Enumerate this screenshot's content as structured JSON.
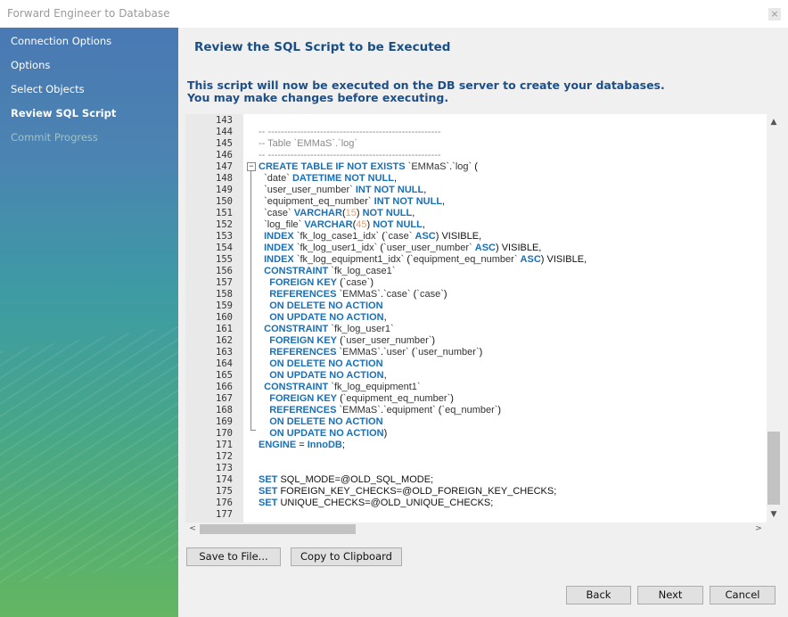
{
  "window": {
    "title": "Forward Engineer to Database",
    "close_glyph": "×"
  },
  "sidebar": {
    "steps": [
      {
        "label": "Connection Options",
        "state": "normal"
      },
      {
        "label": "Options",
        "state": "normal"
      },
      {
        "label": "Select Objects",
        "state": "normal"
      },
      {
        "label": "Review SQL Script",
        "state": "active"
      },
      {
        "label": "Commit Progress",
        "state": "disabled"
      }
    ]
  },
  "page": {
    "title": "Review the SQL Script to be Executed",
    "desc_line1": "This script will now be executed on the DB server to create your databases.",
    "desc_line2": "You may make changes before executing."
  },
  "editor": {
    "fold_glyph": "−",
    "lines": [
      {
        "n": "143",
        "t": [
          [
            "",
            ""
          ]
        ]
      },
      {
        "n": "144",
        "t": [
          [
            "cm",
            "-- -----------------------------------------------------"
          ]
        ]
      },
      {
        "n": "145",
        "t": [
          [
            "cm",
            "-- Table `EMMaS`.`log`"
          ]
        ]
      },
      {
        "n": "146",
        "t": [
          [
            "cm",
            "-- -----------------------------------------------------"
          ]
        ]
      },
      {
        "n": "147",
        "t": [
          [
            "kw",
            "CREATE TABLE IF NOT EXISTS "
          ],
          [
            "str",
            "`EMMaS`"
          ],
          [
            "",
            "."
          ],
          [
            "str",
            "`log`"
          ],
          [
            "",
            " ("
          ]
        ]
      },
      {
        "n": "148",
        "t": [
          [
            "",
            "  "
          ],
          [
            "str",
            "`date`"
          ],
          [
            "",
            " "
          ],
          [
            "kw",
            "DATETIME NOT NULL"
          ],
          [
            "",
            ","
          ]
        ]
      },
      {
        "n": "149",
        "t": [
          [
            "",
            "  "
          ],
          [
            "str",
            "`user_user_number`"
          ],
          [
            "",
            " "
          ],
          [
            "kw",
            "INT NOT NULL"
          ],
          [
            "",
            ","
          ]
        ]
      },
      {
        "n": "150",
        "t": [
          [
            "",
            "  "
          ],
          [
            "str",
            "`equipment_eq_number`"
          ],
          [
            "",
            " "
          ],
          [
            "kw",
            "INT NOT NULL"
          ],
          [
            "",
            ","
          ]
        ]
      },
      {
        "n": "151",
        "t": [
          [
            "",
            "  "
          ],
          [
            "str",
            "`case`"
          ],
          [
            "",
            " "
          ],
          [
            "kw",
            "VARCHAR"
          ],
          [
            "",
            "("
          ],
          [
            "num",
            "15"
          ],
          [
            "",
            ") "
          ],
          [
            "kw",
            "NOT NULL"
          ],
          [
            "",
            ","
          ]
        ]
      },
      {
        "n": "152",
        "t": [
          [
            "",
            "  "
          ],
          [
            "str",
            "`log_file`"
          ],
          [
            "",
            " "
          ],
          [
            "kw",
            "VARCHAR"
          ],
          [
            "",
            "("
          ],
          [
            "num",
            "45"
          ],
          [
            "",
            ") "
          ],
          [
            "kw",
            "NOT NULL"
          ],
          [
            "",
            ","
          ]
        ]
      },
      {
        "n": "153",
        "t": [
          [
            "",
            "  "
          ],
          [
            "kw",
            "INDEX "
          ],
          [
            "str",
            "`fk_log_case1_idx`"
          ],
          [
            "",
            " ("
          ],
          [
            "str",
            "`case`"
          ],
          [
            "",
            " "
          ],
          [
            "kw",
            "ASC"
          ],
          [
            "",
            ") VISIBLE,"
          ]
        ]
      },
      {
        "n": "154",
        "t": [
          [
            "",
            "  "
          ],
          [
            "kw",
            "INDEX "
          ],
          [
            "str",
            "`fk_log_user1_idx`"
          ],
          [
            "",
            " ("
          ],
          [
            "str",
            "`user_user_number`"
          ],
          [
            "",
            " "
          ],
          [
            "kw",
            "ASC"
          ],
          [
            "",
            ") VISIBLE,"
          ]
        ]
      },
      {
        "n": "155",
        "t": [
          [
            "",
            "  "
          ],
          [
            "kw",
            "INDEX "
          ],
          [
            "str",
            "`fk_log_equipment1_idx`"
          ],
          [
            "",
            " ("
          ],
          [
            "str",
            "`equipment_eq_number`"
          ],
          [
            "",
            " "
          ],
          [
            "kw",
            "ASC"
          ],
          [
            "",
            ") VISIBLE,"
          ]
        ]
      },
      {
        "n": "156",
        "t": [
          [
            "",
            "  "
          ],
          [
            "kw",
            "CONSTRAINT "
          ],
          [
            "str",
            "`fk_log_case1`"
          ]
        ]
      },
      {
        "n": "157",
        "t": [
          [
            "",
            "    "
          ],
          [
            "kw",
            "FOREIGN KEY"
          ],
          [
            "",
            " ("
          ],
          [
            "str",
            "`case`"
          ],
          [
            "",
            ")"
          ]
        ]
      },
      {
        "n": "158",
        "t": [
          [
            "",
            "    "
          ],
          [
            "kw",
            "REFERENCES "
          ],
          [
            "str",
            "`EMMaS`"
          ],
          [
            "",
            "."
          ],
          [
            "str",
            "`case`"
          ],
          [
            "",
            " ("
          ],
          [
            "str",
            "`case`"
          ],
          [
            "",
            ")"
          ]
        ]
      },
      {
        "n": "159",
        "t": [
          [
            "",
            "    "
          ],
          [
            "kw",
            "ON DELETE NO ACTION"
          ]
        ]
      },
      {
        "n": "160",
        "t": [
          [
            "",
            "    "
          ],
          [
            "kw",
            "ON UPDATE NO ACTION"
          ],
          [
            "",
            ","
          ]
        ]
      },
      {
        "n": "161",
        "t": [
          [
            "",
            "  "
          ],
          [
            "kw",
            "CONSTRAINT "
          ],
          [
            "str",
            "`fk_log_user1`"
          ]
        ]
      },
      {
        "n": "162",
        "t": [
          [
            "",
            "    "
          ],
          [
            "kw",
            "FOREIGN KEY"
          ],
          [
            "",
            " ("
          ],
          [
            "str",
            "`user_user_number`"
          ],
          [
            "",
            ")"
          ]
        ]
      },
      {
        "n": "163",
        "t": [
          [
            "",
            "    "
          ],
          [
            "kw",
            "REFERENCES "
          ],
          [
            "str",
            "`EMMaS`"
          ],
          [
            "",
            "."
          ],
          [
            "str",
            "`user`"
          ],
          [
            "",
            " ("
          ],
          [
            "str",
            "`user_number`"
          ],
          [
            "",
            ")"
          ]
        ]
      },
      {
        "n": "164",
        "t": [
          [
            "",
            "    "
          ],
          [
            "kw",
            "ON DELETE NO ACTION"
          ]
        ]
      },
      {
        "n": "165",
        "t": [
          [
            "",
            "    "
          ],
          [
            "kw",
            "ON UPDATE NO ACTION"
          ],
          [
            "",
            ","
          ]
        ]
      },
      {
        "n": "166",
        "t": [
          [
            "",
            "  "
          ],
          [
            "kw",
            "CONSTRAINT "
          ],
          [
            "str",
            "`fk_log_equipment1`"
          ]
        ]
      },
      {
        "n": "167",
        "t": [
          [
            "",
            "    "
          ],
          [
            "kw",
            "FOREIGN KEY"
          ],
          [
            "",
            " ("
          ],
          [
            "str",
            "`equipment_eq_number`"
          ],
          [
            "",
            ")"
          ]
        ]
      },
      {
        "n": "168",
        "t": [
          [
            "",
            "    "
          ],
          [
            "kw",
            "REFERENCES "
          ],
          [
            "str",
            "`EMMaS`"
          ],
          [
            "",
            "."
          ],
          [
            "str",
            "`equipment`"
          ],
          [
            "",
            " ("
          ],
          [
            "str",
            "`eq_number`"
          ],
          [
            "",
            ")"
          ]
        ]
      },
      {
        "n": "169",
        "t": [
          [
            "",
            "    "
          ],
          [
            "kw",
            "ON DELETE NO ACTION"
          ]
        ]
      },
      {
        "n": "170",
        "t": [
          [
            "",
            "    "
          ],
          [
            "kw",
            "ON UPDATE NO ACTION"
          ],
          [
            "",
            ")"
          ]
        ]
      },
      {
        "n": "171",
        "t": [
          [
            "kw",
            "ENGINE"
          ],
          [
            "",
            " = "
          ],
          [
            "kw",
            "InnoDB"
          ],
          [
            "",
            ";"
          ]
        ]
      },
      {
        "n": "172",
        "t": [
          [
            "",
            ""
          ]
        ]
      },
      {
        "n": "173",
        "t": [
          [
            "",
            ""
          ]
        ]
      },
      {
        "n": "174",
        "t": [
          [
            "kw",
            "SET"
          ],
          [
            "",
            " SQL_MODE=@OLD_SQL_MODE;"
          ]
        ]
      },
      {
        "n": "175",
        "t": [
          [
            "kw",
            "SET"
          ],
          [
            "",
            " FOREIGN_KEY_CHECKS=@OLD_FOREIGN_KEY_CHECKS;"
          ]
        ]
      },
      {
        "n": "176",
        "t": [
          [
            "kw",
            "SET"
          ],
          [
            "",
            " UNIQUE_CHECKS=@OLD_UNIQUE_CHECKS;"
          ]
        ]
      },
      {
        "n": "177",
        "t": [
          [
            "",
            ""
          ]
        ]
      }
    ],
    "scroll_up_glyph": "▲",
    "scroll_down_glyph": "▼",
    "scroll_left_glyph": "<",
    "scroll_right_glyph": ">"
  },
  "buttons": {
    "save_to_file": "Save to File...",
    "copy_to_clipboard": "Copy to Clipboard",
    "back": "Back",
    "next": "Next",
    "cancel": "Cancel"
  }
}
